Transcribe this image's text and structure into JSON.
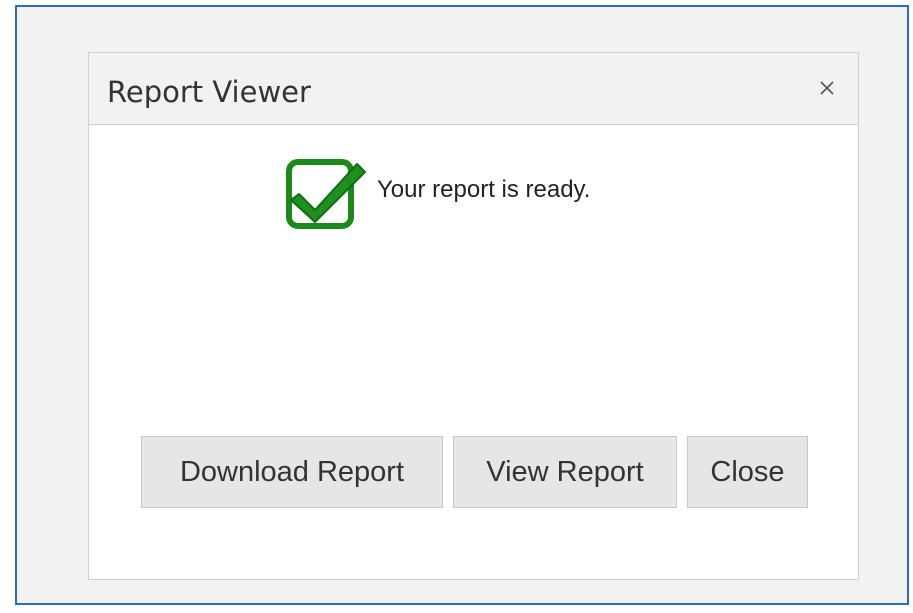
{
  "dialog": {
    "title": "Report Viewer",
    "close_icon": "close-icon",
    "message": "Your report is ready.",
    "status_icon": "checkmark-icon"
  },
  "buttons": {
    "download_label": "Download Report",
    "view_label": "View Report",
    "close_label": "Close"
  },
  "colors": {
    "frame_border": "#2a6cc0",
    "check_green": "#1a8a1a",
    "check_dark": "#0f6e0f",
    "button_bg": "#e6e6e6",
    "header_bg": "#f2f2f2"
  }
}
